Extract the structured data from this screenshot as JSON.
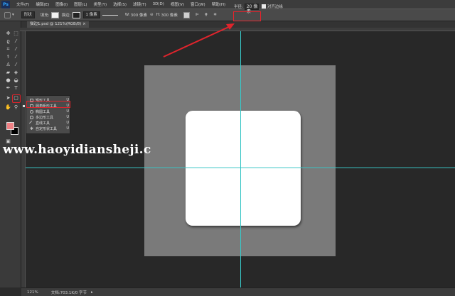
{
  "app": {
    "logo": "Ps"
  },
  "menu": [
    "文件(F)",
    "编辑(E)",
    "图像(I)",
    "图层(L)",
    "类型(Y)",
    "选择(S)",
    "滤镜(T)",
    "3D(D)",
    "视图(V)",
    "窗口(W)",
    "帮助(H)"
  ],
  "options_bar": {
    "shape_mode": "形状",
    "fill_label": "填充:",
    "stroke_label": "描边:",
    "stroke_width": "1 像素",
    "w_label": "W:",
    "w_value": "300 像素",
    "h_label": "H:",
    "h_value": "300 像素",
    "radius_label": "半径:",
    "radius_value": "20 像素",
    "align_edges_label": "对齐边缘"
  },
  "document": {
    "tab_title": "描边1.psd @ 121%(RGB/8) ×"
  },
  "flyout": {
    "items": [
      {
        "label": "矩形工具",
        "key": "U"
      },
      {
        "label": "圆角矩形工具",
        "key": "U"
      },
      {
        "label": "椭圆工具",
        "key": "U"
      },
      {
        "label": "多边形工具",
        "key": "U"
      },
      {
        "label": "直线工具",
        "key": "U"
      },
      {
        "label": "自定形状工具",
        "key": "U"
      }
    ],
    "selected_index": 1
  },
  "watermark": "www.haoyidiansheji.c",
  "status": {
    "zoom": "121%",
    "doc_info": "文档:703.1K/0 字节"
  },
  "colors": {
    "foreground": "#f08084",
    "background": "#000000",
    "guide": "#39c6c6",
    "highlight": "#e0242c",
    "artboard": "#7a7a7a"
  },
  "tools": [
    "move-icon",
    "marquee-icon",
    "lasso-icon",
    "quick-select-icon",
    "crop-icon",
    "eyedropper-icon",
    "healing-icon",
    "brush-icon",
    "stamp-icon",
    "history-brush-icon",
    "eraser-icon",
    "gradient-icon",
    "blur-icon",
    "dodge-icon",
    "pen-icon",
    "type-icon",
    "path-select-icon",
    "rounded-rect-icon",
    "hand-icon",
    "zoom-icon"
  ]
}
